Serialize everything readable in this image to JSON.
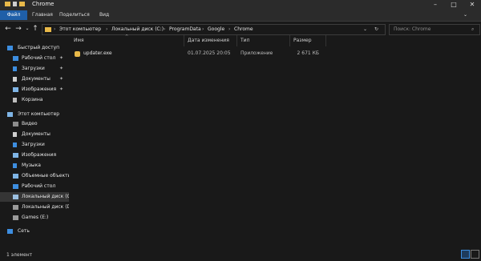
{
  "window": {
    "title": "Chrome"
  },
  "ribbon": {
    "tabs": [
      "Файл",
      "Главная",
      "Поделиться",
      "Вид"
    ]
  },
  "address": {
    "crumbs": [
      "Этот компьютер",
      "Локальный диск (C:)",
      "ProgramData",
      "Google",
      "Chrome"
    ],
    "search_placeholder": "Поиск: Chrome"
  },
  "sidebar": {
    "quick_access": "Быстрый доступ",
    "quick_items": [
      "Рабочий стол",
      "Загрузки",
      "Документы",
      "Изображения",
      "Корзина"
    ],
    "this_pc": "Этот компьютер",
    "pc_items": [
      "Видео",
      "Документы",
      "Загрузки",
      "Изображения",
      "Музыка",
      "Объемные объекты",
      "Рабочий стол",
      "Локальный диск (C:)",
      "Локальный диск (D:)",
      "Games (E:)"
    ],
    "network": "Сеть"
  },
  "columns": {
    "name": "Имя",
    "date": "Дата изменения",
    "type": "Тип",
    "size": "Размер"
  },
  "files": [
    {
      "name": "updater.exe",
      "date": "01.07.2025 20:05",
      "type": "Приложение",
      "size": "2 671 КБ"
    }
  ],
  "status": {
    "count": "1 элемент"
  },
  "colors": {
    "accent": "#1f5fa8",
    "folder": "#e9b949",
    "background": "#191919"
  }
}
